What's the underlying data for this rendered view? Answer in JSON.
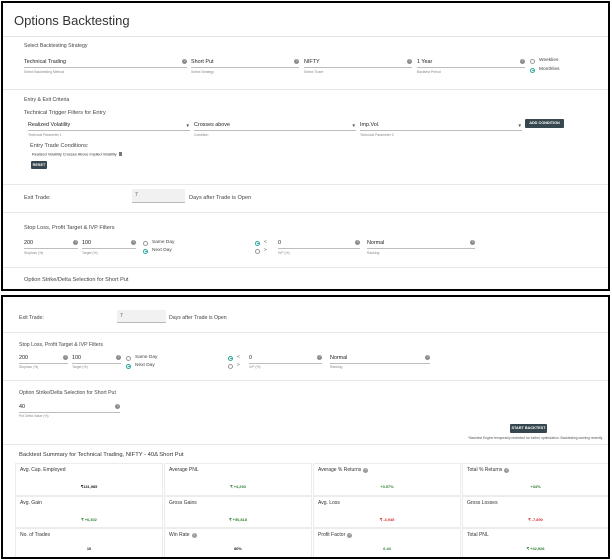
{
  "top": {
    "title": "Options Backtesting",
    "strategy_section": "Select Backtesting Strategy",
    "fields": [
      {
        "value": "Technical Trading",
        "sub": "Select Backtesting Method"
      },
      {
        "value": "Short Put",
        "sub": "Select Strategy"
      },
      {
        "value": "NIFTY",
        "sub": "Select Ticker"
      },
      {
        "value": "1 Year",
        "sub": "Backtest Period"
      }
    ],
    "expiry_options": [
      "Weeklies",
      "Monthlies"
    ],
    "entry_exit": "Entry & Exit Criteria",
    "trigger_filters": "Technical Trigger Filters for Entry",
    "trigger": {
      "param1": "Realized Volatility",
      "param1_sub": "Technical Parameter 1",
      "condition": "Crosses above",
      "condition_sub": "Condition",
      "param2": "Imp.Vol.",
      "param2_sub": "Technical Parameter 2"
    },
    "add_condition": "ADD CONDITION",
    "entry_conditions_title": "Entry Trade Conditions:",
    "entry_condition": "Realized Volatility Crosses Above Implied Volatility",
    "reset": "RESET",
    "exit_trade_label": "Exit Trade:",
    "exit_days": "7",
    "exit_days_suffix": "Days after Trade is Open",
    "sl_section": "Stop Loss, Profit Target & IVP Filters",
    "stoploss": {
      "value": "200",
      "sub": "Stoploss (%)"
    },
    "target": {
      "value": "100",
      "sub": "Target (%)"
    },
    "day_options": [
      "Same Day",
      "Next Day"
    ],
    "ivp_ops": [
      "<",
      ">"
    ],
    "ivp": {
      "value": "0",
      "sub": "IVP (%)"
    },
    "ranking": {
      "value": "Normal",
      "sub": "Ranking"
    },
    "strike_section": "Option Strike/Delta Selection for Short Put"
  },
  "bottom": {
    "exit_trade_label": "Exit Trade:",
    "exit_days": "7",
    "exit_days_suffix": "Days after Trade is Open",
    "sl_section": "Stop Loss, Profit Target & IVP Filters",
    "stoploss": {
      "value": "200",
      "sub": "Stoploss (%)"
    },
    "target": {
      "value": "100",
      "sub": "Target (%)"
    },
    "day_options": [
      "Same Day",
      "Next Day"
    ],
    "ivp_ops": [
      "<",
      ">"
    ],
    "ivp": {
      "value": "0",
      "sub": "IVP (%)"
    },
    "ranking": {
      "value": "Normal",
      "sub": "Ranking"
    },
    "strike_section": "Option Strike/Delta Selection for Short Put",
    "delta": {
      "value": "40",
      "sub": "Put Delta Value (%)"
    },
    "start_button": "START BACKTEST",
    "disclaimer": "*Backtest Engine temporarily restricted for further optimization. Backtesting caching recently.",
    "summary_title": "Backtest Summary for Technical Trading, NIFTY - 40Δ Short Put",
    "cards": [
      {
        "label": "Avg. Cap. Employed",
        "value": "₹131,985",
        "tone": "neu",
        "help": false
      },
      {
        "label": "Average PNL",
        "value": "₹ +4,293",
        "tone": "pos",
        "help": false
      },
      {
        "label": "Average % Returns",
        "value": "+3.57%",
        "tone": "pos",
        "help": true
      },
      {
        "label": "Total % Returns",
        "value": "+34%",
        "tone": "pos",
        "help": true
      },
      {
        "label": "Avg. Gain",
        "value": "₹ +6,302",
        "tone": "pos",
        "help": false
      },
      {
        "label": "Gross Gains",
        "value": "₹ +50,818",
        "tone": "pos",
        "help": false
      },
      {
        "label": "Avg. Loss",
        "value": "₹ -3,945",
        "tone": "neg",
        "help": false
      },
      {
        "label": "Gross Losses",
        "value": "₹ -7,890",
        "tone": "neg",
        "help": false
      },
      {
        "label": "No. of Trades",
        "value": "10",
        "tone": "neu",
        "help": false
      },
      {
        "label": "Win Rate",
        "value": "80%",
        "tone": "neu",
        "help": true
      },
      {
        "label": "Profit Factor",
        "value": "6.44",
        "tone": "pos",
        "help": true
      },
      {
        "label": "Total PNL",
        "value": "₹ +42,928",
        "tone": "pos",
        "help": false
      }
    ]
  }
}
